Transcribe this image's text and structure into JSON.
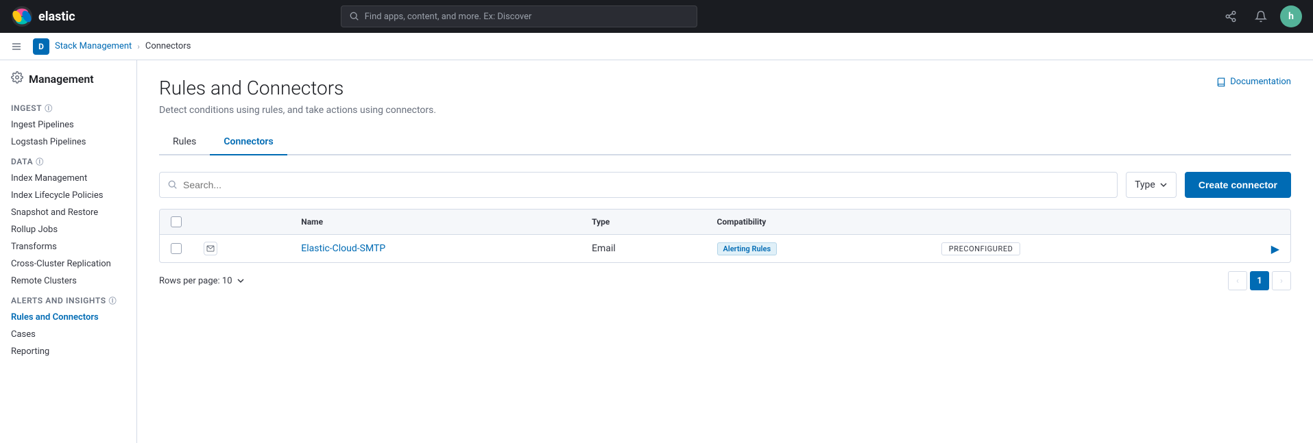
{
  "topbar": {
    "logo_text": "elastic",
    "search_placeholder": "Find apps, content, and more. Ex: Discover",
    "avatar_letter": "h"
  },
  "breadcrumb": {
    "parent_link": "Stack Management",
    "current": "Connectors"
  },
  "sidebar": {
    "title": "Management",
    "sections": [
      {
        "label": "Ingest",
        "has_info": true,
        "items": [
          {
            "label": "Ingest Pipelines",
            "active": false
          },
          {
            "label": "Logstash Pipelines",
            "active": false
          }
        ]
      },
      {
        "label": "Data",
        "has_info": true,
        "items": [
          {
            "label": "Index Management",
            "active": false
          },
          {
            "label": "Index Lifecycle Policies",
            "active": false
          },
          {
            "label": "Snapshot and Restore",
            "active": false
          },
          {
            "label": "Rollup Jobs",
            "active": false
          },
          {
            "label": "Transforms",
            "active": false
          },
          {
            "label": "Cross-Cluster Replication",
            "active": false
          },
          {
            "label": "Remote Clusters",
            "active": false
          }
        ]
      },
      {
        "label": "Alerts and Insights",
        "has_info": true,
        "items": [
          {
            "label": "Rules and Connectors",
            "active": true
          },
          {
            "label": "Cases",
            "active": false
          },
          {
            "label": "Reporting",
            "active": false
          }
        ]
      }
    ]
  },
  "page": {
    "title": "Rules and Connectors",
    "description": "Detect conditions using rules, and take actions using connectors.",
    "doc_link_label": "Documentation"
  },
  "tabs": [
    {
      "label": "Rules",
      "active": false
    },
    {
      "label": "Connectors",
      "active": true
    }
  ],
  "toolbar": {
    "search_placeholder": "Search...",
    "type_label": "Type",
    "create_button_label": "Create connector"
  },
  "table": {
    "columns": [
      {
        "label": ""
      },
      {
        "label": ""
      },
      {
        "label": "Name"
      },
      {
        "label": "Type"
      },
      {
        "label": "Compatibility"
      },
      {
        "label": ""
      },
      {
        "label": ""
      }
    ],
    "rows": [
      {
        "name": "Elastic-Cloud-SMTP",
        "type": "Email",
        "compatibility": "Alerting Rules",
        "status": "PRECONFIGURED"
      }
    ]
  },
  "pagination": {
    "rows_per_page_label": "Rows per page: 10",
    "current_page": "1"
  }
}
